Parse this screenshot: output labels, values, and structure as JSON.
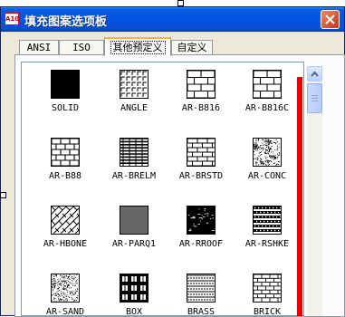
{
  "window": {
    "title": "填充图案选项板",
    "icon": "A10"
  },
  "tabs": [
    {
      "label": "ANSI",
      "active": false
    },
    {
      "label": "ISO",
      "active": false
    },
    {
      "label": "其他预定义",
      "active": true
    },
    {
      "label": "自定义",
      "active": false
    }
  ],
  "patterns": [
    {
      "label": "SOLID",
      "pattern": "solid"
    },
    {
      "label": "ANGLE",
      "pattern": "angle"
    },
    {
      "label": "AR-B816",
      "pattern": "brick-large"
    },
    {
      "label": "AR-B816C",
      "pattern": "brick-large"
    },
    {
      "label": "AR-B88",
      "pattern": "brick-medium"
    },
    {
      "label": "AR-BRELM",
      "pattern": "brick-elm"
    },
    {
      "label": "AR-BRSTD",
      "pattern": "brick-std"
    },
    {
      "label": "AR-CONC",
      "pattern": "concrete"
    },
    {
      "label": "AR-HBONE",
      "pattern": "herringbone"
    },
    {
      "label": "AR-PARQ1",
      "pattern": "parquet"
    },
    {
      "label": "AR-RROOF",
      "pattern": "rroof"
    },
    {
      "label": "AR-RSHKE",
      "pattern": "rshke"
    },
    {
      "label": "AR-SAND",
      "pattern": "sand"
    },
    {
      "label": "BOX",
      "pattern": "box"
    },
    {
      "label": "BRASS",
      "pattern": "brass"
    },
    {
      "label": "BRICK",
      "pattern": "brick-small"
    }
  ],
  "colors": {
    "title_bar": "#0054e3",
    "annotation_line": "#e30000",
    "active_tab_highlight": "#f1b83c"
  }
}
